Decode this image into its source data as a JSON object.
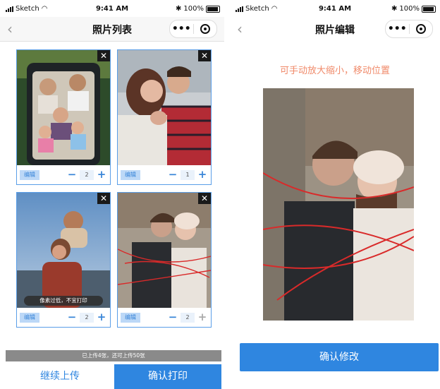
{
  "status_bar": {
    "carrier": "Sketch",
    "time": "9:41 AM",
    "battery": "100%"
  },
  "left_screen": {
    "nav": {
      "title": "照片列表",
      "more_glyph": "•••"
    },
    "photos": [
      {
        "edit_label": "编辑",
        "quantity": "2",
        "close_glyph": "✕"
      },
      {
        "edit_label": "编辑",
        "quantity": "1",
        "close_glyph": "✕"
      },
      {
        "edit_label": "编辑",
        "quantity": "2",
        "close_glyph": "✕",
        "warning": "像素过低，不宜打印"
      },
      {
        "edit_label": "编辑",
        "quantity": "2",
        "close_glyph": "✕"
      }
    ],
    "upload_status": "已上传4张，还可上传50张",
    "continue_button": "继续上传",
    "print_button": "确认打印"
  },
  "right_screen": {
    "nav": {
      "title": "照片编辑",
      "more_glyph": "•••"
    },
    "hint": "可手动放大缩小，移动位置",
    "confirm_button": "确认修改"
  },
  "colors": {
    "accent": "#2f86e0",
    "hint": "#f08a6a",
    "edit_bg": "#bcd8f7",
    "card_border": "#5a9ee8"
  },
  "icons": [
    "back-chevron-icon",
    "more-icon",
    "close-target-icon",
    "close-icon",
    "minus-icon",
    "plus-icon",
    "wifi-icon",
    "bluetooth-icon",
    "battery-icon",
    "signal-icon"
  ]
}
